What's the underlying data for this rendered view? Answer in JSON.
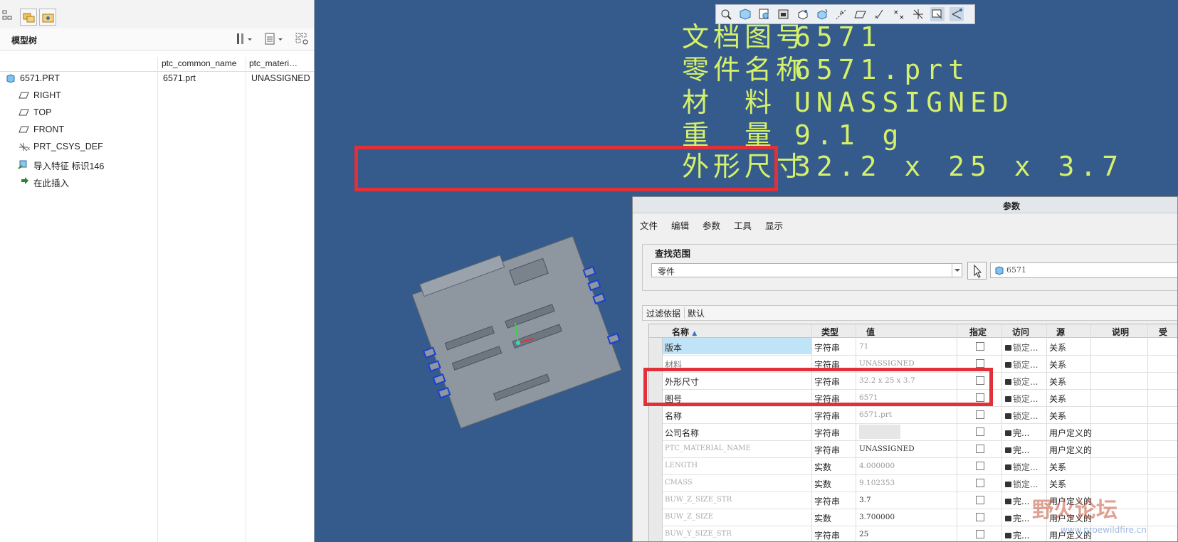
{
  "model_tree": {
    "title": "模型树",
    "columns": [
      "ptc_common_name",
      "ptc_materi…"
    ],
    "items": [
      {
        "name": "6571.PRT",
        "common": "6571.prt",
        "material": "UNASSIGNED"
      },
      {
        "name": "RIGHT"
      },
      {
        "name": "TOP"
      },
      {
        "name": "FRONT"
      },
      {
        "name": "PRT_CSYS_DEF"
      },
      {
        "name": "导入特征 标识146"
      },
      {
        "name": "在此插入"
      }
    ]
  },
  "annotations": [
    {
      "label": "文档图号",
      "value": "6571"
    },
    {
      "label": "零件名称",
      "value": "6571.prt"
    },
    {
      "label": "材　料",
      "value": "UNASSIGNED"
    },
    {
      "label": "重　量",
      "value": "9.1 g"
    },
    {
      "label": "外形尺寸",
      "value": "32.2 x 25 x 3.7"
    }
  ],
  "params_dialog": {
    "title": "参数",
    "menu": [
      "文件",
      "编辑",
      "参数",
      "工具",
      "显示"
    ],
    "scope_label": "查找范围",
    "scope_value": "零件",
    "target": "6571",
    "filter_label": "过滤依据",
    "filter_value": "默认",
    "columns": [
      "名称",
      "类型",
      "值",
      "指定",
      "访问",
      "源",
      "说明",
      "受"
    ],
    "rows": [
      {
        "name": "版本",
        "type": "字符串",
        "value": "71",
        "access": "锁定...",
        "source": "关系"
      },
      {
        "name": "材料",
        "type": "字符串",
        "value": "UNASSIGNED",
        "access": "锁定...",
        "source": "关系"
      },
      {
        "name": "外形尺寸",
        "type": "字符串",
        "value": "32.2 x 25 x 3.7",
        "access": "锁定...",
        "source": "关系"
      },
      {
        "name": "图号",
        "type": "字符串",
        "value": "6571",
        "access": "锁定...",
        "source": "关系"
      },
      {
        "name": "名称",
        "type": "字符串",
        "value": "6571.prt",
        "access": "锁定...",
        "source": "关系"
      },
      {
        "name": "公司名称",
        "type": "字符串",
        "value": "",
        "access": "完...",
        "source": "用户定义的"
      },
      {
        "name": "PTC_MATERIAL_NAME",
        "type": "字符串",
        "value": "UNASSIGNED",
        "access": "完...",
        "source": "用户定义的"
      },
      {
        "name": "LENGTH",
        "type": "实数",
        "value": "4.000000",
        "access": "锁定...",
        "source": "关系"
      },
      {
        "name": "CMASS",
        "type": "实数",
        "value": "9.102353",
        "access": "锁定...",
        "source": "关系"
      },
      {
        "name": "BUW_Z_SIZE_STR",
        "type": "字符串",
        "value": "3.7",
        "access": "完...",
        "source": "用户定义的"
      },
      {
        "name": "BUW_Z_SIZE",
        "type": "实数",
        "value": "3.700000",
        "access": "完...",
        "source": "用户定义的"
      },
      {
        "name": "BUW_Y_SIZE_STR",
        "type": "字符串",
        "value": "25",
        "access": "完...",
        "source": "用户定义的"
      }
    ]
  },
  "watermark": {
    "title": "野火论坛",
    "url": "www.proewildfire.cn"
  }
}
